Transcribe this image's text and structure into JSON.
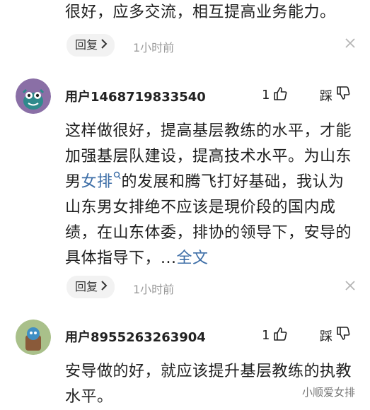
{
  "comments": [
    {
      "text_tail": "很好，应多交流，相互提高业务能力。",
      "reply_label": "回复",
      "time": "1小时前"
    },
    {
      "username": "用户1468719833540",
      "like_count": "1",
      "dislike_label": "踩",
      "text_part1": "这样做很好，提高基层教练的水平，才能加强基层队建设，提高技术水平。为山东男",
      "link_text": "女排",
      "text_part2": "的发展和腾飞打好基础，我认为山东男女排绝不应该是現价段的国内成绩，在山东体委，排协的领导下，安导的具体指导下，...",
      "more_label": "全文",
      "reply_label": "回复",
      "time": "1小时前",
      "avatar_color": "#8a6fa6"
    },
    {
      "username": "用户8955263263904",
      "like_count": "1",
      "dislike_label": "踩",
      "text": "安导做的好，就应该提升基层教练的执教水平。",
      "avatar_color": "#a9c08a"
    }
  ],
  "watermark": "小顺爱女排",
  "icons": [
    "chevron-right-icon",
    "close-icon",
    "thumbs-up-icon",
    "thumbs-down-icon",
    "search-icon"
  ]
}
